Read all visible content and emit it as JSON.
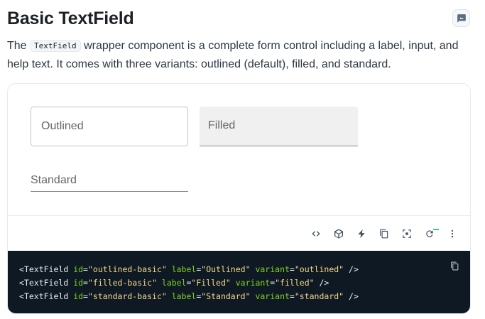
{
  "page": {
    "title": "Basic TextField",
    "description_before": "The ",
    "description_code": "TextField",
    "description_after": " wrapper component is a complete form control including a label, input, and help text. It comes with three variants: outlined (default), filled, and standard."
  },
  "preview": {
    "outlined_label": "Outlined",
    "filled_label": "Filled",
    "standard_label": "Standard"
  },
  "toolbar": {
    "icons": [
      "code-icon",
      "codesandbox-icon",
      "stackblitz-icon",
      "copy-icon",
      "fullscreen-icon",
      "reset-icon",
      "more-icon"
    ]
  },
  "code": {
    "lines": [
      {
        "tag": "TextField",
        "id": "\"outlined-basic\"",
        "label": "\"Outlined\"",
        "variant": "\"outlined\""
      },
      {
        "tag": "TextField",
        "id": "\"filled-basic\"",
        "label": "\"Filled\"",
        "variant": "\"filled\""
      },
      {
        "tag": "TextField",
        "id": "\"standard-basic\"",
        "label": "\"Standard\"",
        "variant": "\"standard\""
      }
    ],
    "attr_id": "id",
    "attr_label": "label",
    "attr_variant": "variant"
  },
  "colors": {
    "code_bg": "#0f1924",
    "attr": "#7ed321",
    "string": "#f3d98a"
  }
}
